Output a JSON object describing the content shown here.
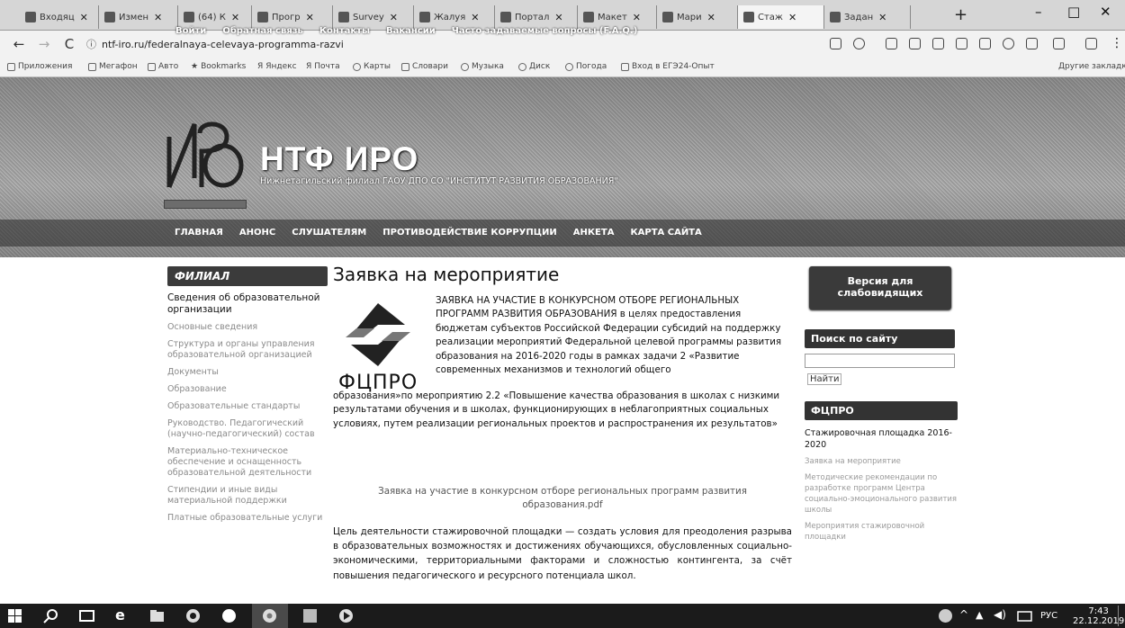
{
  "browser": {
    "tabs": [
      {
        "label": "Входяц"
      },
      {
        "label": "Измен"
      },
      {
        "label": "(64) К"
      },
      {
        "label": "Прогр"
      },
      {
        "label": "Survey"
      },
      {
        "label": "Жалуя"
      },
      {
        "label": "Портал"
      },
      {
        "label": "Макет"
      },
      {
        "label": "Мари"
      },
      {
        "label": "Стаж"
      },
      {
        "label": "Задан"
      }
    ],
    "new_tab": "+",
    "controls": {
      "minimize": "–",
      "maximize": "□",
      "close": "✕"
    },
    "nav": {
      "back": "←",
      "forward": "→",
      "reload": "C"
    },
    "url": "ntf-iro.ru/federalnaya-celevaya-programma-razvi",
    "bookmarks": [
      "Приложения",
      "Мегафон",
      "Авто",
      "Bookmarks",
      "Яндекс",
      "Почта",
      "Карты",
      "Словари",
      "Музыка",
      "Диск",
      "Погода",
      "Вход в ЕГЭ24-Опыт",
      "Другие закладки"
    ]
  },
  "site": {
    "topnav": [
      "Войти",
      "Обратная связь",
      "Контакты",
      "Вакансии",
      "Часто задаваемые вопросы (F.A.Q.)"
    ],
    "name": "НТФ ИРО",
    "subtitle": "Нижнетагильский филиал ГАОУ ДПО СО \"ИНСТИТУТ РАЗВИТИЯ ОБРАЗОВАНИЯ\"",
    "mainnav": [
      "ГЛАВНАЯ",
      "АНОНС",
      "СЛУШАТЕЛЯМ",
      "ПРОТИВОДЕЙСТВИЕ КОРРУПЦИИ",
      "АНКЕТА",
      "КАРТА САЙТА"
    ]
  },
  "leftbar": {
    "title": "ФИЛИАЛ",
    "current": "Сведения об образовательной организации",
    "links": [
      "Основные сведения",
      "Структура и органы управления образовательной организацией",
      "Документы",
      "Образование",
      "Образовательные стандарты",
      "Руководство. Педагогический (научно-педагогический) состав",
      "Материально-техническое обеспечение и оснащенность образовательной деятельности",
      "Стипендии и иные виды материальной поддержки",
      "Платные образовательные услуги"
    ]
  },
  "main": {
    "title": "Заявка на мероприятие",
    "logo_text": "ФЦПРО",
    "intro_caps": "ЗАЯВКА НА УЧАСТИЕ В КОНКУРСНОМ ОТБОРЕ РЕГИОНАЛЬНЫХ ПРОГРАММ РАЗВИТИЯ ОБРАЗОВАНИЯ",
    "intro_body": "в целях предоставления бюджетам субъектов Российской Федерации субсидий на поддержку реализации мероприятий Федеральной целевой программы развития образования на 2016-2020 годы в рамках задачи 2 «Развитие современных механизмов и технологий общего",
    "intro_rest": "образования»по мероприятию 2.2 «Повышение качества образования в школах с низкими результатами обучения и в школах, функционирующих в неблагоприятных социальных условиях, путем реализации региональных проектов и распространения их результатов»",
    "pdf_link": "Заявка на участие в конкурсном отборе региональных программ развития образования.pdf",
    "goal": "Цель деятельности стажировочной площадки — создать условия для преодоления разрыва в образовательных возможностях и достижениях обучающихся, обусловленных социально-экономическими, территориальными факторами и сложностью контингента, за счёт повышения педагогического и ресурсного потенциала школ."
  },
  "rightbar": {
    "vision_button": "Версия для слабовидящих",
    "search_title": "Поиск по сайту",
    "search_placeholder": "",
    "search_button": "Найти",
    "fcpro_title": "ФЦПРО",
    "fcpro_subtitle": "Стажировочная площадка 2016-2020",
    "links": [
      "Заявка на мероприятие",
      "Методические рекомендации по разработке программ Центра социально-эмоционального развития школы",
      "Мероприятия стажировочной площадки"
    ]
  },
  "taskbar": {
    "lang": "РУС",
    "time": "7:43",
    "date": "22.12.2019"
  },
  "colors": {
    "header_dark": "#3b3b3b",
    "taskbar": "#1b1b1b"
  }
}
